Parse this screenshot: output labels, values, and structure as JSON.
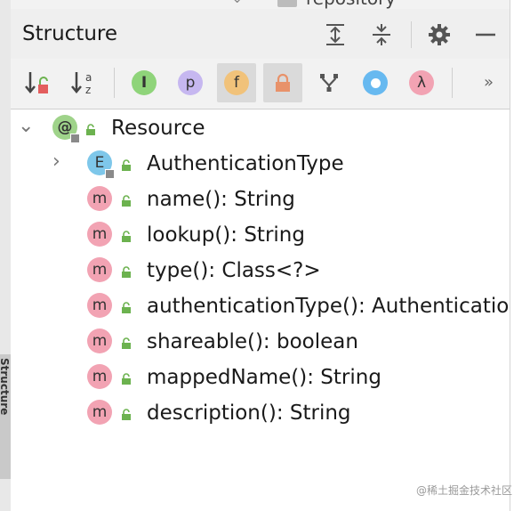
{
  "header": {
    "title": "Structure"
  },
  "topbar": {
    "repo_label": "repository"
  },
  "side_tab": {
    "label": "Structure"
  },
  "toolbar": {
    "more_label": "»"
  },
  "tree": {
    "root": {
      "label": "Resource",
      "badge": "@"
    },
    "children": [
      {
        "label": "AuthenticationType",
        "badge": "E",
        "kind": "enum"
      },
      {
        "label": "name(): String",
        "badge": "m",
        "kind": "method"
      },
      {
        "label": "lookup(): String",
        "badge": "m",
        "kind": "method"
      },
      {
        "label": "type(): Class<?>",
        "badge": "m",
        "kind": "method"
      },
      {
        "label": "authenticationType(): Authenticatio",
        "badge": "m",
        "kind": "method"
      },
      {
        "label": "shareable(): boolean",
        "badge": "m",
        "kind": "method"
      },
      {
        "label": "mappedName(): String",
        "badge": "m",
        "kind": "method"
      },
      {
        "label": "description(): String",
        "badge": "m",
        "kind": "method"
      }
    ]
  },
  "watermark": "@稀土掘金技术社区",
  "colors": {
    "annotation_badge": "#9fd38a",
    "enum_badge": "#7ec7ea",
    "method_badge": "#f2a3b3",
    "lock_green": "#6cb24f",
    "header_bg": "#efefef"
  }
}
